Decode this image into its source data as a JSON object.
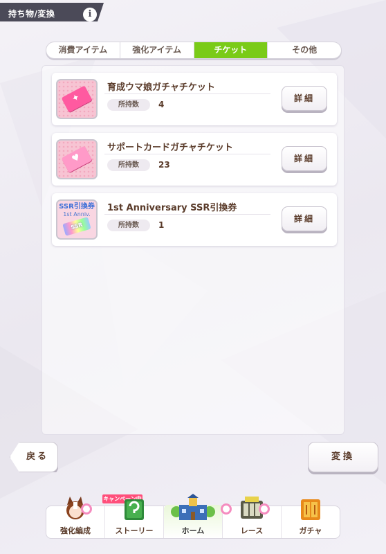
{
  "header": {
    "title": "持ち物/変換",
    "info_label": "i"
  },
  "tabs": [
    {
      "label": "消費アイテム",
      "active": false
    },
    {
      "label": "強化アイテム",
      "active": false
    },
    {
      "label": "チケット",
      "active": true
    },
    {
      "label": "その他",
      "active": false
    }
  ],
  "items": [
    {
      "name": "育成ウマ娘ガチャチケット",
      "qty_label": "所持数",
      "qty": "4",
      "detail_label": "詳細",
      "icon": "ticket-pink-icon"
    },
    {
      "name": "サポートカードガチャチケット",
      "qty_label": "所持数",
      "qty": "23",
      "detail_label": "詳細",
      "icon": "ticket-support-icon"
    },
    {
      "name": "1st Anniversary SSR引換券",
      "qty_label": "所持数",
      "qty": "1",
      "detail_label": "詳細",
      "icon": "ssr-voucher-icon",
      "icon_text": "SSR引換券",
      "icon_sub": "1st Anniv.",
      "icon_ticket": "SSR"
    }
  ],
  "buttons": {
    "back": "戻る",
    "convert": "変換"
  },
  "nav": {
    "campaign_tag": "キャンペーン中",
    "items": [
      {
        "label": "強化編成",
        "icon": "horse-girl-icon"
      },
      {
        "label": "ストーリー",
        "icon": "story-book-icon"
      },
      {
        "label": "ホーム",
        "icon": "home-building-icon"
      },
      {
        "label": "レース",
        "icon": "race-gate-icon"
      },
      {
        "label": "ガチャ",
        "icon": "gacha-door-icon"
      }
    ]
  },
  "colors": {
    "active_tab": "#7acb17",
    "text_brown": "#5a3b2a",
    "header_bg": "#4b4a58",
    "badge": "#f58cbf"
  }
}
